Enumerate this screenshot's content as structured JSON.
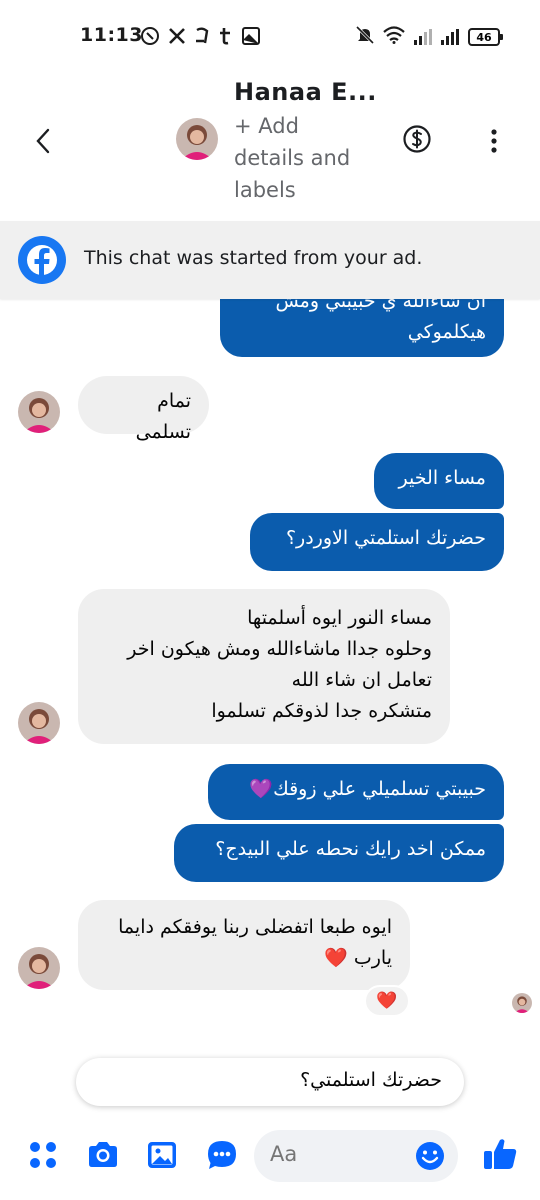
{
  "status_bar": {
    "time": "11:13",
    "battery": "46",
    "left_icons": [
      "whatsapp-icon",
      "x-icon",
      "notification-icon",
      "tumblr-icon",
      "gallery-icon"
    ],
    "right_icons": [
      "mute-icon",
      "wifi-icon",
      "signal-icon",
      "signal-icon",
      "battery-icon"
    ]
  },
  "header": {
    "name": "Hanaa E...",
    "subtitle": "+ Add details and labels"
  },
  "banner": {
    "text": "This chat was started from your ad."
  },
  "messages": [
    {
      "side": "out",
      "text": "ان شاءالله ي حبيبتي ومش\nهيكلموكي"
    },
    {
      "side": "in",
      "text": "تمام تسلمى"
    },
    {
      "side": "out",
      "text": "مساء الخير"
    },
    {
      "side": "out",
      "text": "حضرتك استلمتي الاوردر؟"
    },
    {
      "side": "in",
      "text": "مساء النور ايوه أسلمتها\nوحلوه جداا ماشاءالله ومش هيكون اخر\nتعامل ان شاء الله\nمتشكره جدا لذوقكم تسلموا"
    },
    {
      "side": "out",
      "text": "حبيبتي تسلميلي علي زوقك💜"
    },
    {
      "side": "out",
      "text": "ممكن اخد رايك نحطه علي البيدج؟"
    },
    {
      "side": "in",
      "text": "ايوه طبعا اتفضلى ربنا يوفقكم دايما\nيارب ❤️"
    }
  ],
  "reaction": "❤️",
  "suggestion": "حضرتك استلمتي؟",
  "composer": {
    "placeholder": "Aa"
  },
  "colors": {
    "outgoing_bubble": "#0b5cad",
    "incoming_bubble": "#efefef",
    "accent": "#1877f2"
  }
}
